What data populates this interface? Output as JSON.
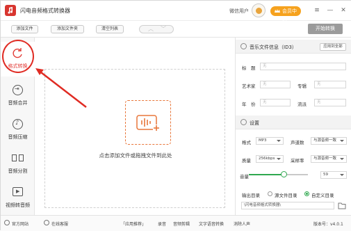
{
  "window": {
    "title": "闪电音频格式转换器",
    "user_label": "微信用户",
    "vip_label": "会员中心",
    "menu_icon": "menu-icon",
    "minimize_icon": "minimize-icon",
    "close_icon": "close-icon"
  },
  "toolbar": {
    "add_file": "添加文件",
    "add_folder": "添加文件夹",
    "clear_list": "清空列表",
    "start_convert": "开始转换"
  },
  "sidebar": {
    "items": [
      {
        "label": "格式转换",
        "icon": "refresh-icon",
        "active": true
      },
      {
        "label": "音频合并",
        "icon": "merge-icon",
        "active": false
      },
      {
        "label": "音频压缩",
        "icon": "music-note-icon",
        "active": false
      },
      {
        "label": "音频分割",
        "icon": "split-icon",
        "active": false
      },
      {
        "label": "视频转音频",
        "icon": "play-icon",
        "active": false
      }
    ]
  },
  "main": {
    "drop_text": "点击添加文件或拖拽文件到此处"
  },
  "info": {
    "header": "音乐文件信息（ID3）",
    "apply_all": "应用到全部",
    "title_label": "标　题",
    "title_placeholder": "无",
    "artist_label": "艺术家",
    "artist_placeholder": "无",
    "album_label": "专辑",
    "album_placeholder": "无",
    "year_label": "年　份",
    "year_placeholder": "无",
    "genre_label": "流派",
    "genre_placeholder": "无"
  },
  "settings": {
    "header": "设置",
    "format_label": "格式",
    "format_value": "MP3",
    "channels_label": "声道数",
    "channels_value": "与源音频一致",
    "quality_label": "质量",
    "quality_value": "256kbps",
    "samplerate_label": "采样率",
    "samplerate_value": "与源音频一致",
    "volume_label": "音量",
    "volume_value": "59",
    "output_label": "输出目录",
    "output_opt_source": "源文件目录",
    "output_opt_custom": "自定义目录",
    "output_selected": "自定义目录",
    "output_path": "\\闪电音频格式转换器\\",
    "colors": {
      "accent": "#2fa84f",
      "brand": "#e23a35",
      "vip": "#f6a21e"
    }
  },
  "statusbar": {
    "website": "官方网站",
    "service": "在线客服",
    "promo": "「应用推荐」",
    "links": [
      "录音",
      "音频剪辑",
      "文字语音转换",
      "消除人声"
    ],
    "version": "版本号：v4.0.1"
  }
}
